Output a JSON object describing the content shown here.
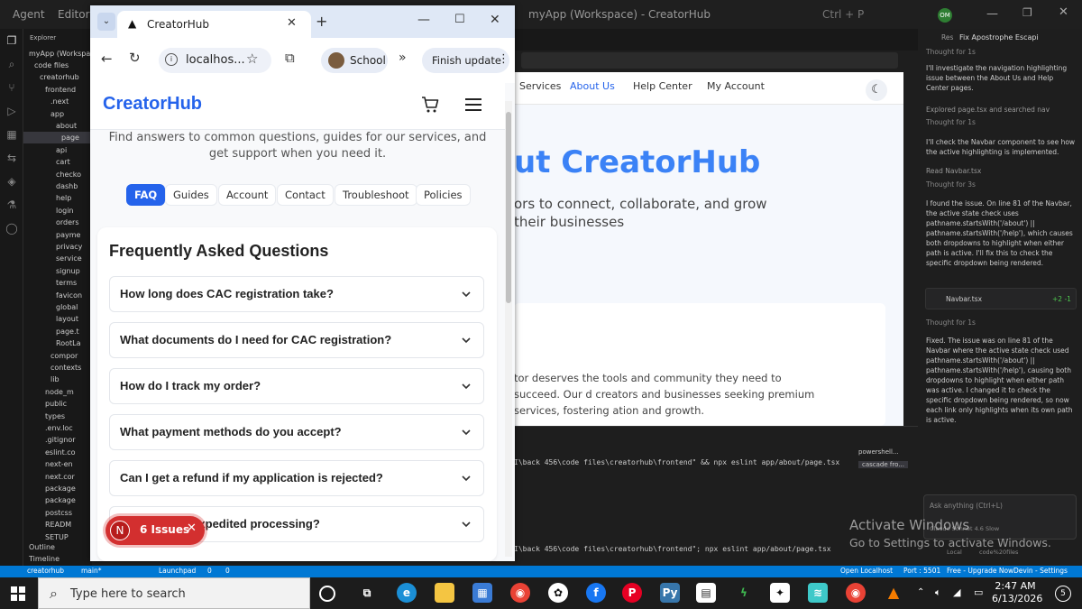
{
  "ide": {
    "menu_agent": "Agent",
    "menu_editor": "Editor",
    "window_title": "myApp (Workspace) - CreatorHub",
    "shortcut": "Ctrl + P",
    "avatar_initials": "OM",
    "explorer_title": "Explorer",
    "workspace": "myApp (Workspace)",
    "tree": [
      "code files",
      "creatorhub",
      "frontend",
      ".next",
      "app",
      "about",
      "page",
      "api",
      "cart",
      "checko",
      "dashb",
      "help",
      "login",
      "orders",
      "payme",
      "privacy",
      "service",
      "signup",
      "terms",
      "favicon",
      "global",
      "layout",
      "page.t",
      "RootLa",
      "compor",
      "contexts",
      "lib",
      "node_m",
      "public",
      "types",
      ".env.loc",
      ".gitignor",
      "eslint.co",
      "next-en",
      "next.cor",
      "package",
      "package",
      "postcss",
      "READM",
      "SETUP"
    ],
    "outline": "Outline",
    "timeline": "Timeline",
    "preview_nav": [
      "Services",
      "About Us",
      "Help Center",
      "My Account"
    ],
    "hero_title": "ut CreatorHub",
    "hero_sub": "ors to connect, collaborate, and grow their businesses",
    "card_text": "tor deserves the tools and community they need to succeed. Our d creators and businesses seeking premium services, fostering ation and growth.",
    "terminal_line1": "I\\back 456\\code files\\creatorhub\\frontend\" && npx eslint app/about/page.tsx",
    "terminal_line2": "I\\back 456\\code files\\creatorhub\\frontend\"; npx eslint app/about/page.tsx",
    "terminal_panes": [
      "powershell...",
      "cascade fro..."
    ],
    "chat_header": "Fix Apostrophe Escapi",
    "chat_res": "Res",
    "chat": [
      "Thought for 1s",
      "I'll investigate the navigation highlighting issue between the About Us and Help Center pages.",
      "Explored page.tsx and searched nav",
      "Thought for 1s",
      "I'll check the Navbar component to see how the active highlighting is implemented.",
      "Read Navbar.tsx",
      "Thought for 3s",
      "I found the issue. On line 81 of the Navbar, the active state check uses pathname.startsWith('/about') || pathname.startsWith('/help'), which causes both dropdowns to highlight when either path is active. I'll fix this to check the specific dropdown being rendered.",
      "Navbar.tsx",
      "+2 -1",
      "Thought for 1s",
      "Fixed. The issue was on line 81 of the Navbar where the active state check used pathname.startsWith('/about') || pathname.startsWith('/help'), causing both dropdowns to highlight when either path was active. I changed it to check the specific dropdown being rendered, so now each link only highlights when its own path is active.",
      "Ask anything (Ctrl+L)",
      "Claude Sonnet 4.6 Slow",
      "Local",
      "code%20files"
    ],
    "watermark1": "Activate Windows",
    "watermark2": "Go to Settings to activate Windows.",
    "status": [
      "creatorhub",
      "main*",
      "Launchpad",
      "0",
      "0",
      "Open Localhost",
      "Port : 5501",
      "Free - Upgrade Now",
      "Devin - Settings"
    ]
  },
  "browser": {
    "tab_title": "CreatorHub",
    "url": "localhos...",
    "profile": "School",
    "update_btn": "Finish update",
    "logo": "CreatorHub",
    "intro": "Find answers to common questions, guides for our services, and get support when you need it.",
    "tabs": [
      "FAQ",
      "Guides",
      "Account",
      "Contact",
      "Troubleshoot",
      "Policies"
    ],
    "faq_heading": "Frequently Asked Questions",
    "faq": [
      "How long does CAC registration take?",
      "What documents do I need for CAC registration?",
      "How do I track my order?",
      "What payment methods do you accept?",
      "Can I get a refund if my application is rejected?",
      "Do you offer expedited processing?"
    ],
    "issues_label": "6 Issues",
    "issues_letter": "N"
  },
  "taskbar": {
    "search_placeholder": "Type here to search",
    "time": "2:47 AM",
    "date": "6/13/2026",
    "notif": "5"
  }
}
